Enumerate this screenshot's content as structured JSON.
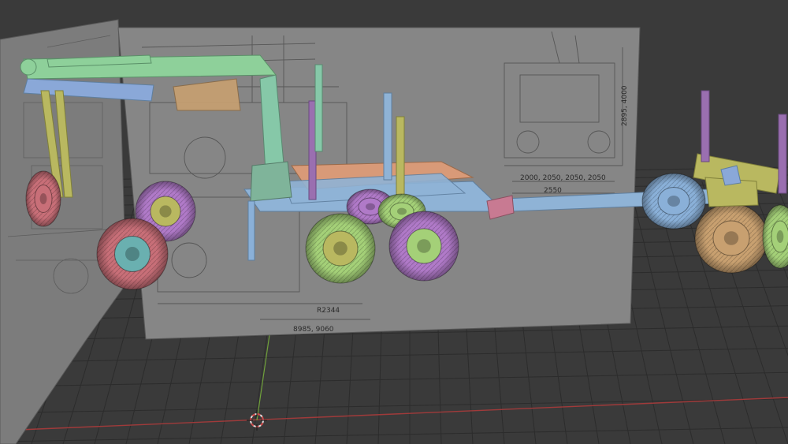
{
  "viewport": {
    "background": "#3a3a3a",
    "grid_color": "#2c2c2c",
    "x_axis_color": "#a03a3a",
    "y_axis_color": "#6fa03a"
  },
  "blueprint": {
    "dim_height": "2895, 4000",
    "dim_track": "2000, 2050, 2050, 2050",
    "dim_width": "2550",
    "dim_cab": "R2344",
    "dim_length": "8985, 9060"
  },
  "model": {
    "name": "Forestry log truck with trailer",
    "colors": {
      "boom": "#8ed09a",
      "boom_arm": "#8aa8d8",
      "crane_column": "#86c8a8",
      "bunk": "#d89a78",
      "stakes": "#b9b860",
      "stake_purple": "#9a6fb0",
      "frame": "#8fb3d6",
      "tire_green": "#a4d078",
      "tire_purple": "#b07ac8",
      "tire_red": "#c86f78",
      "tire_blue": "#8ab0d8",
      "tire_tan": "#c8a070",
      "hub_teal": "#6ab0b0"
    }
  },
  "gizmo": {
    "name": "3d-cursor"
  }
}
